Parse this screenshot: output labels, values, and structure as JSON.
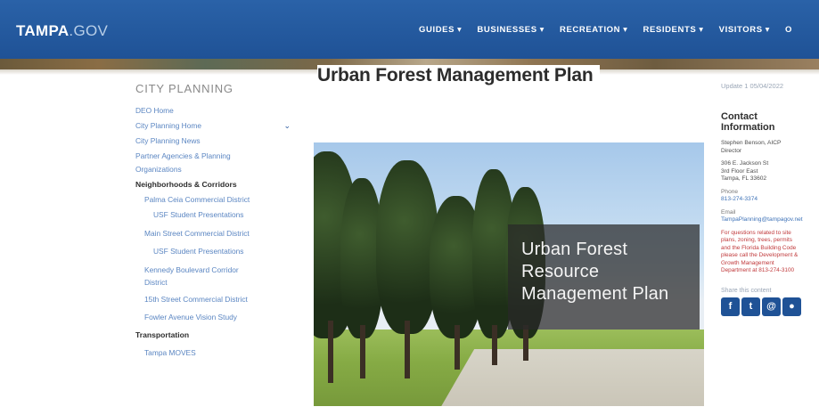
{
  "header": {
    "logo_main": "TAMPA",
    "logo_suffix": ".GOV",
    "nav": [
      {
        "label": "GUIDES"
      },
      {
        "label": "BUSINESSES"
      },
      {
        "label": "RECREATION"
      },
      {
        "label": "RESIDENTS"
      },
      {
        "label": "VISITORS"
      },
      {
        "label": "O"
      }
    ]
  },
  "page": {
    "title": "Urban Forest Management Plan"
  },
  "sidebar": {
    "header": "CITY PLANNING",
    "items": [
      {
        "label": "DEO Home",
        "type": "link",
        "indent": 0
      },
      {
        "label": "City Planning Home",
        "type": "link",
        "indent": 0
      },
      {
        "label": "City Planning News",
        "type": "link",
        "indent": 0
      },
      {
        "label": "Partner Agencies & Planning",
        "type": "link",
        "indent": 0
      },
      {
        "label": "Organizations",
        "type": "link",
        "indent": 0
      },
      {
        "label": "Neighborhoods & Corridors",
        "type": "heading",
        "indent": 0
      },
      {
        "label": "Palma Ceia Commercial District",
        "type": "link",
        "indent": 1
      },
      {
        "label": "USF Student Presentations",
        "type": "link",
        "indent": 2
      },
      {
        "label": "Main Street Commercial District",
        "type": "link",
        "indent": 1
      },
      {
        "label": "USF Student Presentations",
        "type": "link",
        "indent": 2
      },
      {
        "label": "Kennedy Boulevard Corridor",
        "type": "link",
        "indent": 1
      },
      {
        "label": "District",
        "type": "link",
        "indent": 1
      },
      {
        "label": "15th Street Commercial District",
        "type": "link",
        "indent": 1
      },
      {
        "label": "Fowler Avenue Vision Study",
        "type": "link",
        "indent": 1
      },
      {
        "label": "Transportation",
        "type": "heading",
        "indent": 0
      },
      {
        "label": "Tampa MOVES",
        "type": "link",
        "indent": 1
      }
    ]
  },
  "hero": {
    "overlay_lines": [
      "Urban Forest",
      "Resource",
      "Management Plan"
    ]
  },
  "right": {
    "updated": "Update 1 05/04/2022",
    "contact_title_line1": "Contact",
    "contact_title_line2": "Information",
    "name": "Stephen Benson, AICP",
    "role": "Director",
    "address1": "306 E. Jackson St",
    "address2": "3rd Floor East",
    "address3": "Tampa, FL 33602",
    "phone_label": "Phone",
    "phone": "813-274-3374",
    "email_label": "Email",
    "email": "TampaPlanning@tampagov.net",
    "note_lines": [
      "For questions related to site",
      "plans, zoning, trees, permits",
      "and the Florida Building Code",
      "please call the Development &",
      "Growth Management",
      "Department at 813-274-3100"
    ],
    "share_label": "Share this content",
    "share_icons": [
      {
        "name": "facebook-icon",
        "glyph": "f"
      },
      {
        "name": "twitter-icon",
        "glyph": "t"
      },
      {
        "name": "email-icon",
        "glyph": "@"
      },
      {
        "name": "print-icon",
        "glyph": "●"
      }
    ]
  },
  "colors": {
    "nav_bg": "#1f5296",
    "link": "#5b86c2",
    "alert": "#c0393b"
  }
}
